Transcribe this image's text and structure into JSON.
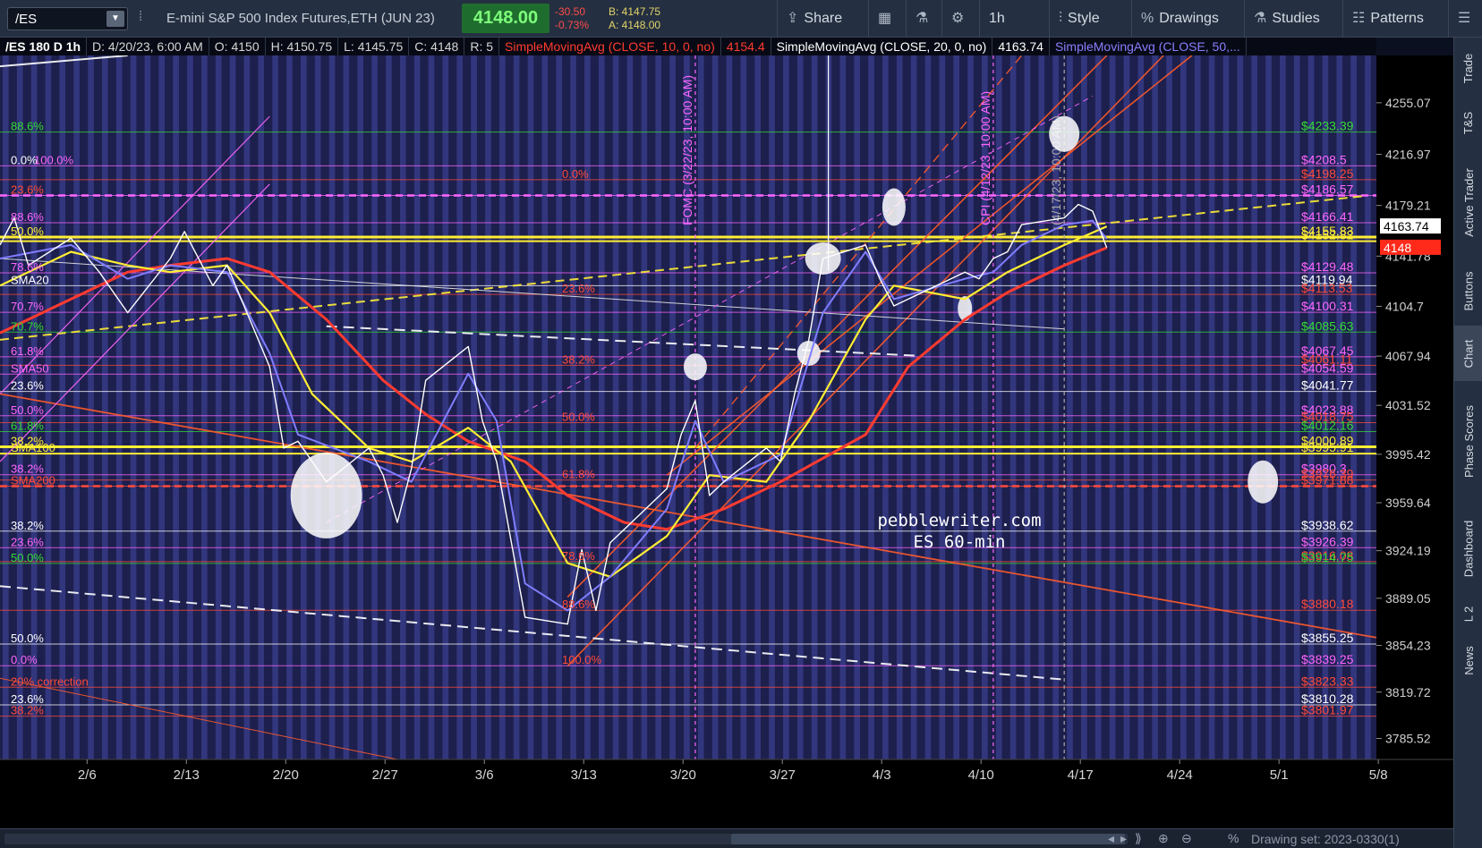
{
  "toolbar": {
    "symbol": "/ES",
    "description": "E-mini S&P 500 Index Futures,ETH (JUN 23)",
    "last": "4148.00",
    "change": "-30.50",
    "change_pct": "-0.73%",
    "bid": "B: 4147.75",
    "ask": "A: 4148.00",
    "share": "Share",
    "interval": "1h",
    "style": "Style",
    "drawings": "Drawings",
    "studies": "Studies",
    "patterns": "Patterns"
  },
  "header": {
    "symbol_period": "/ES 180 D 1h",
    "date": "D: 4/20/23, 6:00 AM",
    "open": "O: 4150",
    "high": "H: 4150.75",
    "low": "L: 4145.75",
    "close": "C: 4148",
    "range": "R: 5",
    "sma10_label": "SimpleMovingAvg (CLOSE, 10, 0, no)",
    "sma10_value": "4154.4",
    "sma20_label": "SimpleMovingAvg (CLOSE, 20, 0, no)",
    "sma20_value": "4163.74",
    "sma50_label": "SimpleMovingAvg (CLOSE, 50,..."
  },
  "sidebar": [
    "Trade",
    "T&S",
    "Active Trader",
    "Buttons",
    "Chart",
    "Phase Scores",
    "Dashboard",
    "L 2",
    "News"
  ],
  "bottom": {
    "drawing_set": "Drawing set: 2023-0330(1)"
  },
  "colors": {
    "background": "#1d1f4d",
    "stripe": "#3a3f8e",
    "sma10": "#ff3b30",
    "sma20": "#ffee33",
    "sma50": "#7f7dff",
    "price": "#ffffff",
    "fib_magenta": "#ff66ff",
    "fib_green": "#33dd33",
    "fib_red": "#ff4a3a",
    "channel": "#ff5a2a"
  },
  "chart_data": {
    "type": "line",
    "title": "/ES 180 D 1h",
    "watermark": [
      "pebblewriter.com",
      "ES 60-min"
    ],
    "yaxis": {
      "range": [
        3770,
        4290
      ],
      "ticks": [
        4255.07,
        4216.97,
        4179.21,
        4141.78,
        4104.7,
        4067.94,
        4031.52,
        3995.42,
        3959.64,
        3924.19,
        3889.05,
        3854.23,
        3819.72,
        3785.52
      ]
    },
    "xaxis": {
      "labels": [
        "2/6",
        "2/13",
        "2/20",
        "2/27",
        "3/6",
        "3/13",
        "3/20",
        "3/27",
        "4/3",
        "4/10",
        "4/17",
        "4/24",
        "5/1",
        "5/8"
      ]
    },
    "last_price_tags": [
      {
        "value": 4163.74,
        "label": "4163.74",
        "color": "#ffffff",
        "text_color": "#000000"
      },
      {
        "value": 4148,
        "label": "4148",
        "color": "#ff2a1a",
        "text_color": "#ffffff"
      }
    ],
    "series": [
      {
        "name": "Price (1h)",
        "color": "#ffffff",
        "points": [
          [
            "2/1",
            4150
          ],
          [
            "2/2",
            4170
          ],
          [
            "2/3",
            4135
          ],
          [
            "2/6",
            4155
          ],
          [
            "2/8",
            4130
          ],
          [
            "2/10",
            4100
          ],
          [
            "2/13",
            4140
          ],
          [
            "2/14",
            4160
          ],
          [
            "2/16",
            4120
          ],
          [
            "2/17",
            4135
          ],
          [
            "2/20",
            4060
          ],
          [
            "2/21",
            4000
          ],
          [
            "2/22",
            4005
          ],
          [
            "2/24",
            3975
          ],
          [
            "2/27",
            4000
          ],
          [
            "2/28",
            3980
          ],
          [
            "3/1",
            3945
          ],
          [
            "3/2",
            3985
          ],
          [
            "3/3",
            4050
          ],
          [
            "3/6",
            4075
          ],
          [
            "3/7",
            4020
          ],
          [
            "3/8",
            3990
          ],
          [
            "3/10",
            3875
          ],
          [
            "3/13",
            3870
          ],
          [
            "3/14",
            3925
          ],
          [
            "3/15",
            3880
          ],
          [
            "3/16",
            3930
          ],
          [
            "3/17",
            3940
          ],
          [
            "3/20",
            3970
          ],
          [
            "3/21",
            4010
          ],
          [
            "3/22",
            4035
          ],
          [
            "3/23",
            3965
          ],
          [
            "3/24",
            3975
          ],
          [
            "3/27",
            4000
          ],
          [
            "3/28",
            3990
          ],
          [
            "3/29",
            4040
          ],
          [
            "3/30",
            4080
          ],
          [
            "3/31",
            4140
          ],
          [
            "4/3",
            4150
          ],
          [
            "4/4",
            4125
          ],
          [
            "4/5",
            4105
          ],
          [
            "4/6",
            4110
          ],
          [
            "4/10",
            4130
          ],
          [
            "4/11",
            4125
          ],
          [
            "4/12",
            4140
          ],
          [
            "4/13",
            4145
          ],
          [
            "4/14",
            4165
          ],
          [
            "4/17",
            4170
          ],
          [
            "4/18",
            4180
          ],
          [
            "4/19",
            4175
          ],
          [
            "4/20",
            4148
          ]
        ]
      },
      {
        "name": "SMA10",
        "color": "#7f7dff",
        "points": [
          [
            "2/1",
            4140
          ],
          [
            "2/6",
            4150
          ],
          [
            "2/10",
            4125
          ],
          [
            "2/13",
            4135
          ],
          [
            "2/17",
            4130
          ],
          [
            "2/20",
            4070
          ],
          [
            "2/22",
            4010
          ],
          [
            "2/27",
            3990
          ],
          [
            "3/2",
            3975
          ],
          [
            "3/6",
            4055
          ],
          [
            "3/8",
            4020
          ],
          [
            "3/10",
            3900
          ],
          [
            "3/13",
            3880
          ],
          [
            "3/16",
            3905
          ],
          [
            "3/20",
            3955
          ],
          [
            "3/22",
            4020
          ],
          [
            "3/24",
            3975
          ],
          [
            "3/28",
            3995
          ],
          [
            "3/31",
            4100
          ],
          [
            "4/3",
            4145
          ],
          [
            "4/5",
            4110
          ],
          [
            "4/10",
            4125
          ],
          [
            "4/12",
            4130
          ],
          [
            "4/14",
            4150
          ],
          [
            "4/17",
            4165
          ],
          [
            "4/19",
            4168
          ],
          [
            "4/20",
            4154.4
          ]
        ]
      },
      {
        "name": "SMA20",
        "color": "#ffee33",
        "points": [
          [
            "2/1",
            4120
          ],
          [
            "2/6",
            4145
          ],
          [
            "2/10",
            4135
          ],
          [
            "2/13",
            4130
          ],
          [
            "2/17",
            4135
          ],
          [
            "2/20",
            4100
          ],
          [
            "2/23",
            4040
          ],
          [
            "2/27",
            4000
          ],
          [
            "3/2",
            3990
          ],
          [
            "3/6",
            4015
          ],
          [
            "3/9",
            3990
          ],
          [
            "3/13",
            3915
          ],
          [
            "3/16",
            3905
          ],
          [
            "3/20",
            3935
          ],
          [
            "3/23",
            3980
          ],
          [
            "3/27",
            3975
          ],
          [
            "3/30",
            4020
          ],
          [
            "4/3",
            4095
          ],
          [
            "4/5",
            4120
          ],
          [
            "4/10",
            4110
          ],
          [
            "4/13",
            4130
          ],
          [
            "4/17",
            4150
          ],
          [
            "4/20",
            4163.74
          ]
        ]
      },
      {
        "name": "SMA50",
        "color": "#ff3b30",
        "points": [
          [
            "2/1",
            4085
          ],
          [
            "2/6",
            4110
          ],
          [
            "2/10",
            4130
          ],
          [
            "2/13",
            4135
          ],
          [
            "2/17",
            4140
          ],
          [
            "2/20",
            4130
          ],
          [
            "2/24",
            4095
          ],
          [
            "2/28",
            4050
          ],
          [
            "3/3",
            4025
          ],
          [
            "3/6",
            4005
          ],
          [
            "3/10",
            3990
          ],
          [
            "3/13",
            3965
          ],
          [
            "3/17",
            3945
          ],
          [
            "3/20",
            3940
          ],
          [
            "3/24",
            3955
          ],
          [
            "3/28",
            3975
          ],
          [
            "4/3",
            4010
          ],
          [
            "4/6",
            4060
          ],
          [
            "4/10",
            4095
          ],
          [
            "4/13",
            4115
          ],
          [
            "4/17",
            4135
          ],
          [
            "4/20",
            4148
          ]
        ]
      }
    ],
    "horizontal_levels": [
      {
        "value": 4233.39,
        "label": "$4233.39",
        "color": "#33dd33"
      },
      {
        "value": 4208.5,
        "label": "$4208.5",
        "color": "#ff66ff"
      },
      {
        "value": 4198.25,
        "label": "$4198.25",
        "color": "#ff4a3a"
      },
      {
        "value": 4186.57,
        "label": "$4186.57",
        "color": "#ff66ff"
      },
      {
        "value": 4166.41,
        "label": "$4166.41",
        "color": "#ff66ff"
      },
      {
        "value": 4155.83,
        "label": "$4155.83",
        "color": "#ffee33"
      },
      {
        "value": 4152.82,
        "label": "$4152.82",
        "color": "#ffee33"
      },
      {
        "value": 4129.48,
        "label": "$4129.48",
        "color": "#ff66ff"
      },
      {
        "value": 4119.94,
        "label": "$4119.94",
        "color": "#ffffff"
      },
      {
        "value": 4113.53,
        "label": "$4113.53",
        "color": "#ff4a3a"
      },
      {
        "value": 4100.31,
        "label": "$4100.31",
        "color": "#ff66ff"
      },
      {
        "value": 4085.63,
        "label": "$4085.63",
        "color": "#33dd33"
      },
      {
        "value": 4067.45,
        "label": "$4067.45",
        "color": "#ff66ff"
      },
      {
        "value": 4061.11,
        "label": "$4061.11",
        "color": "#ff4a3a"
      },
      {
        "value": 4054.59,
        "label": "$4054.59",
        "color": "#ff66ff"
      },
      {
        "value": 4041.77,
        "label": "$4041.77",
        "color": "#ffffff"
      },
      {
        "value": 4023.88,
        "label": "$4023.88",
        "color": "#ff66ff"
      },
      {
        "value": 4018.75,
        "label": "$4018.75",
        "color": "#ff4a3a"
      },
      {
        "value": 4012.16,
        "label": "$4012.16",
        "color": "#33dd33"
      },
      {
        "value": 4000.89,
        "label": "$4000.89",
        "color": "#ffee33"
      },
      {
        "value": 3995.91,
        "label": "$3995.91",
        "color": "#ffee33"
      },
      {
        "value": 3980.3,
        "label": "$3980.3",
        "color": "#ff66ff"
      },
      {
        "value": 3976.39,
        "label": "$3976.39",
        "color": "#ff4a3a"
      },
      {
        "value": 3971.88,
        "label": "$3971.88",
        "color": "#ff4a3a"
      },
      {
        "value": 3938.62,
        "label": "$3938.62",
        "color": "#ffffff"
      },
      {
        "value": 3926.39,
        "label": "$3926.39",
        "color": "#ff66ff"
      },
      {
        "value": 3916.08,
        "label": "$3916.08",
        "color": "#ff4a3a"
      },
      {
        "value": 3914.75,
        "label": "$3914.75",
        "color": "#33dd33"
      },
      {
        "value": 3880.18,
        "label": "$3880.18",
        "color": "#ff4a3a"
      },
      {
        "value": 3855.25,
        "label": "$3855.25",
        "color": "#ffffff"
      },
      {
        "value": 3839.25,
        "label": "$3839.25",
        "color": "#ff66ff"
      },
      {
        "value": 3823.33,
        "label": "$3823.33",
        "color": "#ff4a3a"
      },
      {
        "value": 3810.28,
        "label": "$3810.28",
        "color": "#ffffff"
      },
      {
        "value": 3801.97,
        "label": "$3801.97",
        "color": "#ff4a3a"
      }
    ],
    "left_labels": [
      {
        "value": 4233.39,
        "label": "88.6%",
        "color": "#33dd33"
      },
      {
        "value": 4208.5,
        "label": "0.0%",
        "color": "#ffffff"
      },
      {
        "value": 4208.5,
        "label": "100.0%",
        "color": "#ff66ff"
      },
      {
        "value": 4186.57,
        "label": "23.6%",
        "color": "#ff4a3a"
      },
      {
        "value": 4166.41,
        "label": "88.6%",
        "color": "#ff66ff"
      },
      {
        "value": 4155.83,
        "label": "50.0%",
        "color": "#ffee33"
      },
      {
        "value": 4129.48,
        "label": "78.6%",
        "color": "#ff66ff"
      },
      {
        "value": 4119.94,
        "label": "SMA20",
        "color": "#ffffff"
      },
      {
        "value": 4100.31,
        "label": "70.7%",
        "color": "#ff66ff"
      },
      {
        "value": 4085.63,
        "label": "70.7%",
        "color": "#33dd33"
      },
      {
        "value": 4067.45,
        "label": "61.8%",
        "color": "#ff66ff"
      },
      {
        "value": 4054.59,
        "label": "SMA50",
        "color": "#ff66ff"
      },
      {
        "value": 4041.77,
        "label": "23.6%",
        "color": "#ffffff"
      },
      {
        "value": 4023.88,
        "label": "50.0%",
        "color": "#ff66ff"
      },
      {
        "value": 4012.16,
        "label": "61.8%",
        "color": "#33dd33"
      },
      {
        "value": 4000.89,
        "label": "38.2%",
        "color": "#ffee33"
      },
      {
        "value": 3995.91,
        "label": "SMA100",
        "color": "#ffee33"
      },
      {
        "value": 3980.3,
        "label": "38.2%",
        "color": "#ff66ff"
      },
      {
        "value": 3971.88,
        "label": "SMA200",
        "color": "#ff4a3a"
      },
      {
        "value": 3938.62,
        "label": "38.2%",
        "color": "#ffffff"
      },
      {
        "value": 3926.39,
        "label": "23.6%",
        "color": "#ff66ff"
      },
      {
        "value": 3914.75,
        "label": "50.0%",
        "color": "#33dd33"
      },
      {
        "value": 3855.25,
        "label": "50.0%",
        "color": "#ffffff"
      },
      {
        "value": 3839.25,
        "label": "0.0%",
        "color": "#ff66ff"
      },
      {
        "value": 3823.33,
        "label": "20% correction",
        "color": "#ff4a3a"
      },
      {
        "value": 3810.28,
        "label": "23.6%",
        "color": "#ffffff"
      },
      {
        "value": 3801.97,
        "label": "38.2%",
        "color": "#ff4a3a"
      }
    ],
    "mid_fib_labels": [
      {
        "value": 4198.25,
        "label": "0.0%"
      },
      {
        "value": 4113.53,
        "label": "23.6%"
      },
      {
        "value": 4061.11,
        "label": "38.2%"
      },
      {
        "value": 4018.75,
        "label": "50.0%"
      },
      {
        "value": 3976.39,
        "label": "61.8%"
      },
      {
        "value": 3916.08,
        "label": "78.6%"
      },
      {
        "value": 3880.18,
        "label": "88.6%"
      },
      {
        "value": 3839.25,
        "label": "100.0%"
      }
    ],
    "event_markers": [
      {
        "date": "3/22",
        "label": "FOMC (3/22/23, 10:00 AM)",
        "color": "#ff66ff"
      },
      {
        "date": "4/12",
        "label": "CPI (4/12/23, 10:00 AM)",
        "color": "#ff66ff"
      },
      {
        "date": "4/17",
        "label": "(4/17/23, 10:00 AM)",
        "color": "#aaaaaa"
      }
    ],
    "grid": false,
    "legend": "top-left header"
  }
}
